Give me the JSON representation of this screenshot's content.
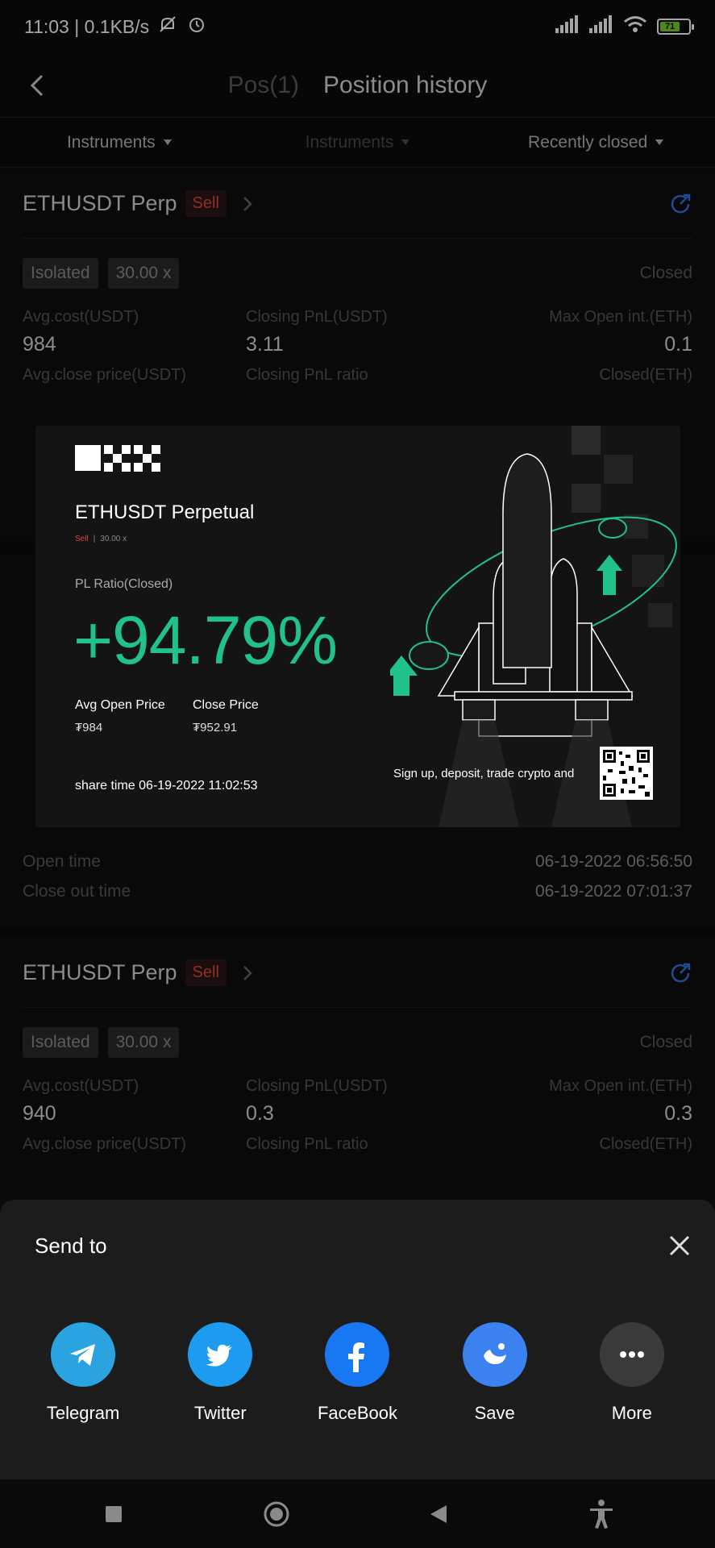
{
  "status_bar": {
    "time_speed": "11:03 | 0.1KB/s",
    "battery": "71"
  },
  "header": {
    "tab_positions": "Pos(1)",
    "tab_history": "Position history"
  },
  "filters": {
    "filter1": "Instruments",
    "filter2": "Instruments",
    "filter3": "Recently closed"
  },
  "card1": {
    "pair": "ETHUSDT Perp",
    "side": "Sell",
    "margin_mode": "Isolated",
    "leverage": "30.00 x",
    "status": "Closed",
    "avg_cost_label": "Avg.cost(USDT)",
    "avg_cost": "984",
    "closing_pnl_label": "Closing PnL(USDT)",
    "closing_pnl": "3.11",
    "max_open_label": "Max Open int.(ETH)",
    "max_open": "0.1",
    "avg_close_label": "Avg.close price(USDT)",
    "pnl_ratio_label": "Closing PnL ratio",
    "closed_eth_label": "Closed(ETH)"
  },
  "card2": {
    "open_time_label": "Open time",
    "open_time": "06-19-2022 06:56:50",
    "close_time_label": "Close out time",
    "close_time": "06-19-2022 07:01:37"
  },
  "card3": {
    "pair": "ETHUSDT Perp",
    "side": "Sell",
    "margin_mode": "Isolated",
    "leverage": "30.00 x",
    "status": "Closed",
    "avg_cost_label": "Avg.cost(USDT)",
    "avg_cost": "940",
    "closing_pnl_label": "Closing PnL(USDT)",
    "closing_pnl": "0.3",
    "max_open_label": "Max Open int.(ETH)",
    "max_open": "0.3",
    "avg_close_label": "Avg.close price(USDT)",
    "pnl_ratio_label": "Closing PnL ratio",
    "closed_eth_label": "Closed(ETH)"
  },
  "share_card": {
    "title": "ETHUSDT Perpetual",
    "side": "Sell",
    "leverage": "30.00 x",
    "pl_label": "PL Ratio(Closed)",
    "pl_value": "+94.79%",
    "avg_open_label": "Avg Open Price",
    "avg_open_value": "₮984",
    "close_label": "Close Price",
    "close_value": "₮952.91",
    "share_time": "share time 06-19-2022 11:02:53",
    "tagline": "Sign up, deposit, trade crypto and"
  },
  "sheet": {
    "title": "Send to",
    "items": [
      {
        "label": "Telegram",
        "color": "#2aa3e0"
      },
      {
        "label": "Twitter",
        "color": "#1d9bf0"
      },
      {
        "label": "FaceBook",
        "color": "#1877f2"
      },
      {
        "label": "Save",
        "color": "#3b82f0"
      },
      {
        "label": "More",
        "color": "#3a3a3a"
      }
    ]
  },
  "colors": {
    "profit": "#21c18a",
    "sell": "#e2453d",
    "accent": "#2f74e0"
  }
}
